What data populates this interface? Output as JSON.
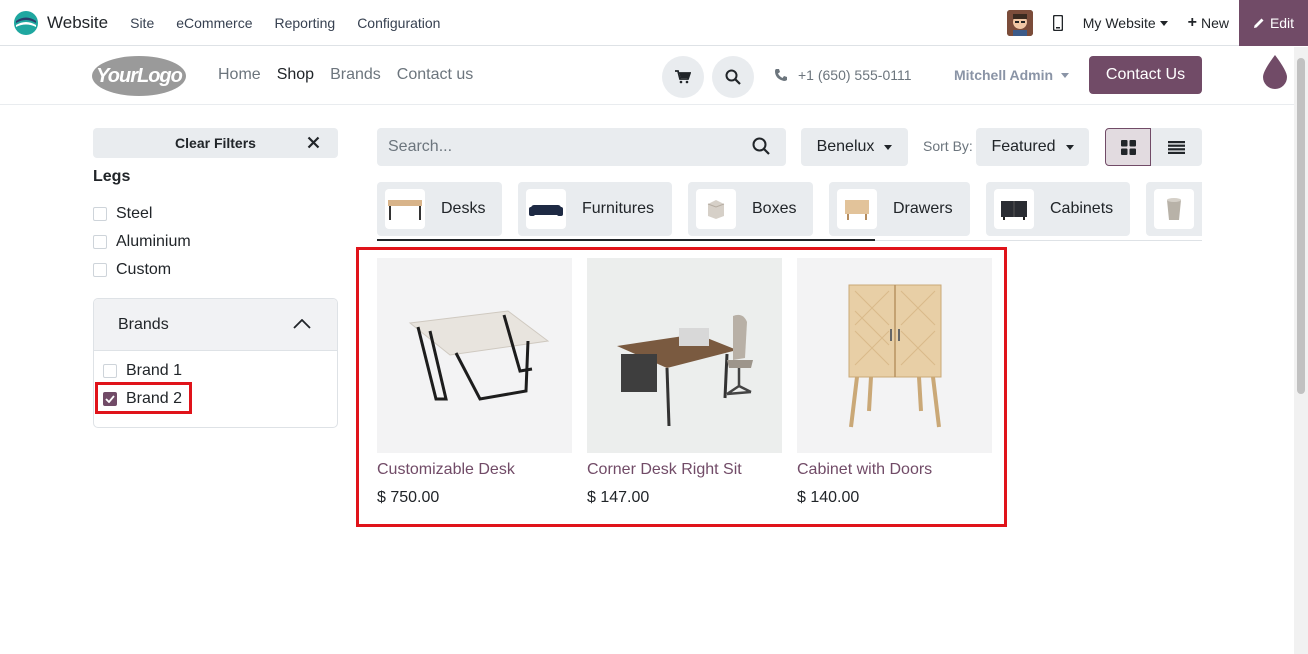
{
  "topbar": {
    "app_name": "Website",
    "menus": [
      "Site",
      "eCommerce",
      "Reporting",
      "Configuration"
    ],
    "my_website": "My Website",
    "new_label": "New",
    "edit_label": "Edit"
  },
  "header": {
    "logo_text": "YourLogo",
    "nav": [
      "Home",
      "Shop",
      "Brands",
      "Contact us"
    ],
    "active_nav": "Shop",
    "phone": "+1 (650) 555-0111",
    "user": "Mitchell Admin",
    "contact_button": "Contact Us"
  },
  "sidebar": {
    "clear_filters": "Clear Filters",
    "legs_title": "Legs",
    "legs_options": [
      {
        "label": "Steel",
        "checked": false
      },
      {
        "label": "Aluminium",
        "checked": false
      },
      {
        "label": "Custom",
        "checked": false
      }
    ],
    "brands_title": "Brands",
    "brand_options": [
      {
        "label": "Brand 1",
        "checked": false
      },
      {
        "label": "Brand 2",
        "checked": true
      }
    ]
  },
  "toolbar": {
    "search_placeholder": "Search...",
    "pricelist": "Benelux",
    "sort_label": "Sort By:",
    "sort_value": "Featured"
  },
  "categories": [
    "Desks",
    "Furnitures",
    "Boxes",
    "Drawers",
    "Cabinets"
  ],
  "products": [
    {
      "name": "Customizable Desk",
      "price": "$ 750.00"
    },
    {
      "name": "Corner Desk Right Sit",
      "price": "$ 147.00"
    },
    {
      "name": "Cabinet with Doors",
      "price": "$ 140.00"
    }
  ],
  "colors": {
    "accent": "#714b67",
    "highlight": "#e0131a"
  }
}
